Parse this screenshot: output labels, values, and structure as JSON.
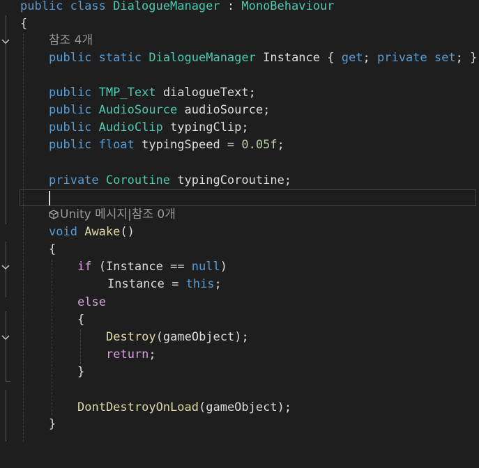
{
  "codelens": {
    "refs_instance": "참조 4개",
    "awake_lens": "Unity 메시지|참조 0개"
  },
  "icons": {
    "fold": "chevron-down-icon",
    "unity": "unity-cube-icon"
  },
  "colors": {
    "background": "#1e1e1e",
    "keyword": "#569cd6",
    "type": "#4ec9b0",
    "method": "#dcdcaa",
    "number": "#b5cea8",
    "control": "#d8a0df",
    "text": "#dcdcdc",
    "codelens": "#999999"
  },
  "code": {
    "l1": {
      "kw1": "public",
      "kw2": "class",
      "name": "DialogueManager",
      "colon": " : ",
      "base": "MonoBehaviour"
    },
    "l2": {
      "brace": "{"
    },
    "l3": {
      "kw1": "public",
      "kw2": "static",
      "type": "DialogueManager",
      "name": "Instance",
      "open": "{",
      "get": "get",
      "semi1": ";",
      "priv": "private",
      "set": "set",
      "semi2": ";",
      "close": "}"
    },
    "l4": {
      "kw": "public",
      "type": "TMP_Text",
      "name": "dialogueText;"
    },
    "l5": {
      "kw": "public",
      "type": "AudioSource",
      "name": "audioSource;"
    },
    "l6": {
      "kw": "public",
      "type": "AudioClip",
      "name": "typingClip;"
    },
    "l7": {
      "kw": "public",
      "type": "float",
      "name": "typingSpeed = ",
      "num": "0.05f",
      "semi": ";"
    },
    "l8": {
      "kw": "private",
      "type": "Coroutine",
      "name": "typingCoroutine;"
    },
    "l9": {
      "kw": "void",
      "name": "Awake",
      "parens": "()"
    },
    "l10": {
      "brace": "{"
    },
    "l11": {
      "kw": "if",
      "open": "(Instance == ",
      "null": "null",
      "close": ")"
    },
    "l12": {
      "name": "Instance = ",
      "this": "this",
      "semi": ";"
    },
    "l13": {
      "kw": "else"
    },
    "l14": {
      "brace": "{"
    },
    "l15": {
      "fn": "Destroy",
      "args": "(gameObject);"
    },
    "l16": {
      "kw": "return",
      "semi": ";"
    },
    "l17": {
      "brace": "}"
    },
    "l18": {
      "fn": "DontDestroyOnLoad",
      "args": "(gameObject);"
    },
    "l19": {
      "brace": "}"
    }
  }
}
